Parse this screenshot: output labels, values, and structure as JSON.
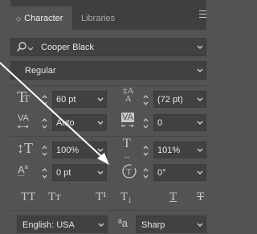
{
  "tabs": {
    "active": "Character",
    "inactive": "Libraries"
  },
  "font": {
    "family": "Cooper Black",
    "style": "Regular"
  },
  "size": {
    "font_size": "60 pt",
    "leading": "(72 pt)"
  },
  "spacing": {
    "kerning": "Auto",
    "tracking": "0"
  },
  "scale": {
    "vertical": "100%",
    "horizontal": "101%"
  },
  "shift": {
    "baseline": "0 pt",
    "rotation": "0°"
  },
  "type_buttons": {
    "all_caps": "TT",
    "small_caps": "Tт",
    "superscript": "T¹",
    "subscript": "T₁",
    "underline": "T",
    "strike": "T"
  },
  "bottom": {
    "language": "English: USA",
    "aa_glyph": "ªa",
    "antialias": "Sharp"
  },
  "colors": {
    "panel": "#535353",
    "tabbar": "#3f3f3f",
    "field": "#414141",
    "arrow": "#ffffff"
  },
  "icons": [
    "search-icon",
    "chevron-down-icon",
    "font-size-icon",
    "leading-icon",
    "kerning-icon",
    "tracking-icon",
    "vertical-scale-icon",
    "horizontal-scale-icon",
    "baseline-shift-icon",
    "rotation-icon",
    "panel-menu-icon"
  ]
}
